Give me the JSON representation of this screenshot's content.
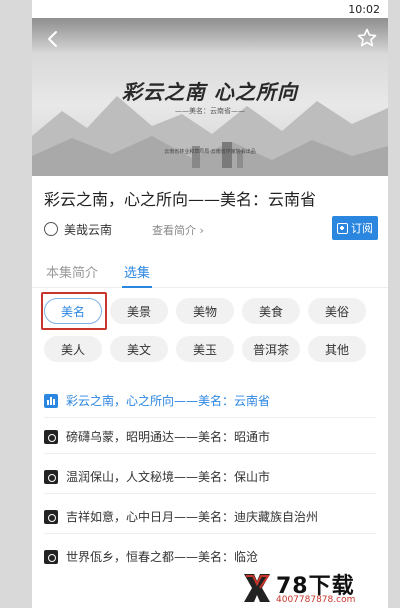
{
  "status_bar": {
    "time": "10:02"
  },
  "hero": {
    "title": "彩云之南 心之所向",
    "subtitle": "——美名：云南省——",
    "caption": "云南省林业和草原局·云南省作家协会出品"
  },
  "episode": {
    "title": "彩云之南，心之所向——美名：云南省"
  },
  "author": {
    "name": "美哉云南",
    "view_intro": "查看简介 ›",
    "subscribe_label": "订阅"
  },
  "tabs": {
    "intro": "本集简介",
    "episodes": "选集"
  },
  "chips": [
    "美名",
    "美景",
    "美物",
    "美食",
    "美俗",
    "美人",
    "美文",
    "美玉",
    "普洱茶",
    "其他"
  ],
  "selected_chip": "美名",
  "list": [
    {
      "title": "彩云之南，心之所向——美名：云南省",
      "active": true
    },
    {
      "title": "磅礴乌蒙，昭明通达——美名：昭通市",
      "active": false
    },
    {
      "title": "温润保山，人文秘境——美名：保山市",
      "active": false
    },
    {
      "title": "吉祥如意，心中日月——美名：迪庆藏族自治州",
      "active": false
    },
    {
      "title": "世界佤乡，恒春之都——美名：临沧",
      "active": false
    }
  ],
  "watermark": {
    "brand": "78下载",
    "url": "4007787878.com"
  },
  "colors": {
    "accent": "#2b86e0",
    "highlight": "#c8352b"
  }
}
